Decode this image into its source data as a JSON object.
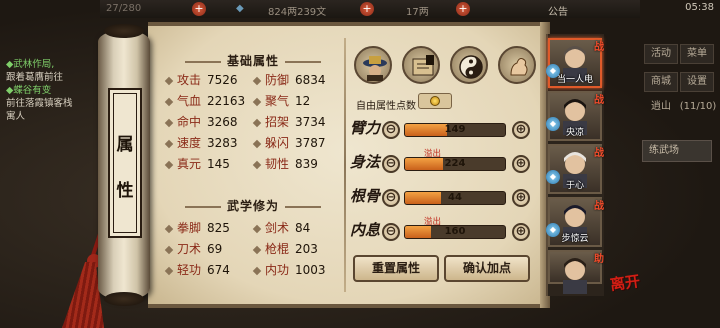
{
  "topbar": {
    "resource1": "27/280",
    "silver": "824两239文",
    "gold": "17两",
    "announce": "公告",
    "time": "05:38"
  },
  "quest": {
    "line1": "◆武林作局,",
    "line2": "跟着葛膺前往",
    "line3": "◆蝶谷有变",
    "line4": "前往落霞镇客栈",
    "line5": "寓人"
  },
  "right_menu": {
    "items": [
      "活动",
      "菜单",
      "商城",
      "设置",
      "逍山"
    ],
    "level": "(11/10)",
    "training": "练武场"
  },
  "scroll_title": [
    "属",
    "性"
  ],
  "base_attrs": {
    "title": "基础属性",
    "items": [
      {
        "label": "攻击",
        "value": "7526"
      },
      {
        "label": "防御",
        "value": "6834"
      },
      {
        "label": "气血",
        "value": "22163"
      },
      {
        "label": "聚气",
        "value": "12"
      },
      {
        "label": "命中",
        "value": "3268"
      },
      {
        "label": "招架",
        "value": "3734"
      },
      {
        "label": "速度",
        "value": "3283"
      },
      {
        "label": "躲闪",
        "value": "3787"
      },
      {
        "label": "真元",
        "value": "145"
      },
      {
        "label": "韧性",
        "value": "839"
      }
    ]
  },
  "martial": {
    "title": "武学修为",
    "items": [
      {
        "label": "拳脚",
        "value": "825"
      },
      {
        "label": "剑术",
        "value": "84"
      },
      {
        "label": "刀术",
        "value": "69"
      },
      {
        "label": "枪棍",
        "value": "203"
      },
      {
        "label": "轻功",
        "value": "674"
      },
      {
        "label": "内功",
        "value": "1003"
      }
    ]
  },
  "free_points_label": "自由属性点数",
  "attributes": [
    {
      "glyph": "臂力",
      "value": "149",
      "fill": 0.42,
      "overflow": ""
    },
    {
      "glyph": "身法",
      "value": "224",
      "fill": 0.38,
      "overflow": "溢出"
    },
    {
      "glyph": "根骨",
      "value": "44",
      "fill": 0.36,
      "overflow": ""
    },
    {
      "glyph": "内息",
      "value": "160",
      "fill": 0.26,
      "overflow": "溢出"
    }
  ],
  "buttons": {
    "reset": "重置属性",
    "confirm": "确认加点",
    "minus": "⊖",
    "plus": "⊕"
  },
  "party": [
    {
      "name": "当一人电",
      "tag": "战",
      "selected": true
    },
    {
      "name": "央凉",
      "tag": "战"
    },
    {
      "name": "于心",
      "tag": "战"
    },
    {
      "name": "步惊云",
      "tag": "战"
    },
    {
      "name": "",
      "tag": "助"
    }
  ],
  "leave": "离开"
}
